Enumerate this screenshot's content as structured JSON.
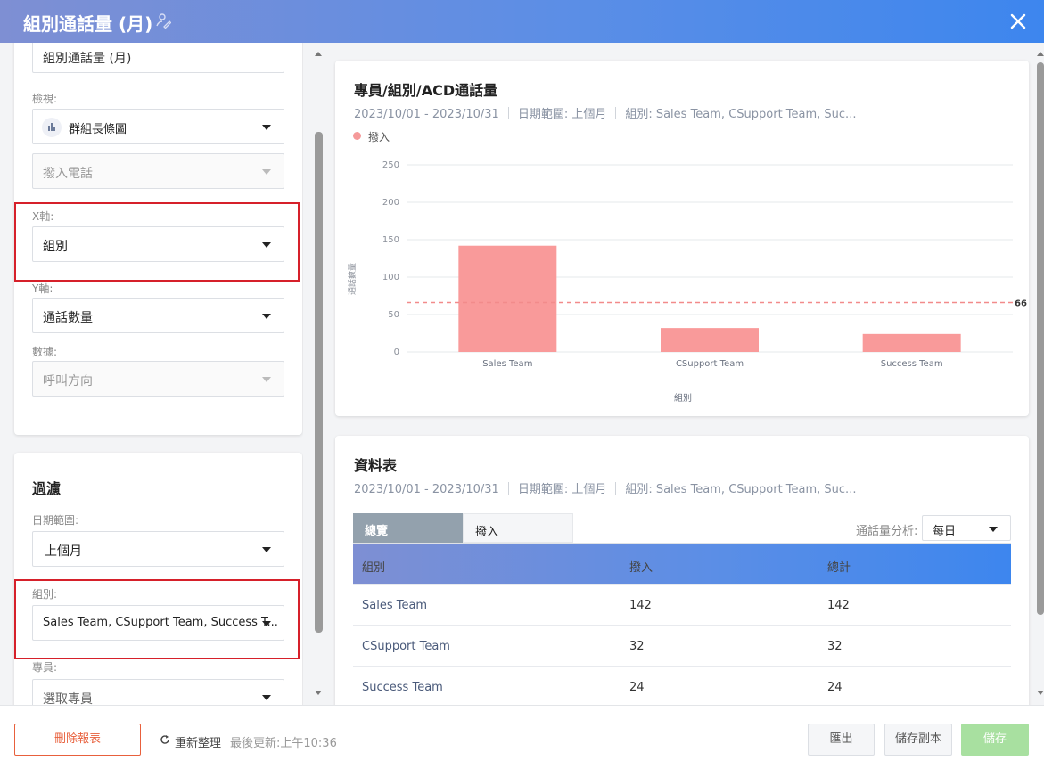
{
  "header": {
    "title": "組別通話量 (月)"
  },
  "left": {
    "name_value": "組別通話量 (月)",
    "view_label": "檢視:",
    "view_value": "群組長條圖",
    "call_type_value": "撥入電話",
    "x_axis_label": "X軸:",
    "x_axis_value": "組別",
    "y_axis_label": "Y軸:",
    "y_axis_value": "通話數量",
    "data_label": "數據:",
    "data_value": "呼叫方向",
    "filter_title": "過濾",
    "date_range_label": "日期範圍:",
    "date_range_value": "上個月",
    "group_label": "組別:",
    "group_value": "Sales Team, CSupport Team, Success T...",
    "agent_label": "專員:",
    "agent_value": "選取專員"
  },
  "chart_card": {
    "title": "專員/組別/ACD通話量",
    "date": "2023/10/01 - 2023/10/31",
    "range": "日期範圍: 上個月",
    "groups": "組別: Sales Team, CSupport Team, Suc..."
  },
  "chart_data": {
    "type": "bar",
    "categories": [
      "Sales Team",
      "CSupport Team",
      "Success Team"
    ],
    "series": [
      {
        "name": "撥入",
        "values": [
          142,
          32,
          24
        ]
      }
    ],
    "xlabel": "組別",
    "ylabel": "通話數量",
    "ylim": [
      0,
      250
    ],
    "yticks": [
      0,
      50,
      100,
      150,
      200,
      250
    ],
    "average_line": 66,
    "average_label": "66",
    "grid": true,
    "legend": "top-left",
    "bar_color": "#f99a9a"
  },
  "table_card": {
    "title": "資料表",
    "date": "2023/10/01 - 2023/10/31",
    "range": "日期範圍: 上個月",
    "groups": "組別: Sales Team, CSupport Team, Suc...",
    "tabs": [
      "總覽",
      "撥入"
    ],
    "analysis_label": "通話量分析:",
    "analysis_value": "每日",
    "columns": [
      "組別",
      "撥入",
      "總計"
    ],
    "rows": [
      [
        "Sales Team",
        "142",
        "142"
      ],
      [
        "CSupport Team",
        "32",
        "32"
      ],
      [
        "Success Team",
        "24",
        "24"
      ]
    ]
  },
  "footer": {
    "delete_label": "刪除報表",
    "refresh_label": "重新整理",
    "last_updated": "最後更新:上午10:36",
    "export_label": "匯出",
    "save_copy_label": "儲存副本",
    "save_label": "儲存"
  },
  "colors": {
    "accent": "#3d86ee",
    "danger": "#d6202a",
    "bar": "#f99a9a",
    "save_disabled": "#a8e0a0"
  }
}
